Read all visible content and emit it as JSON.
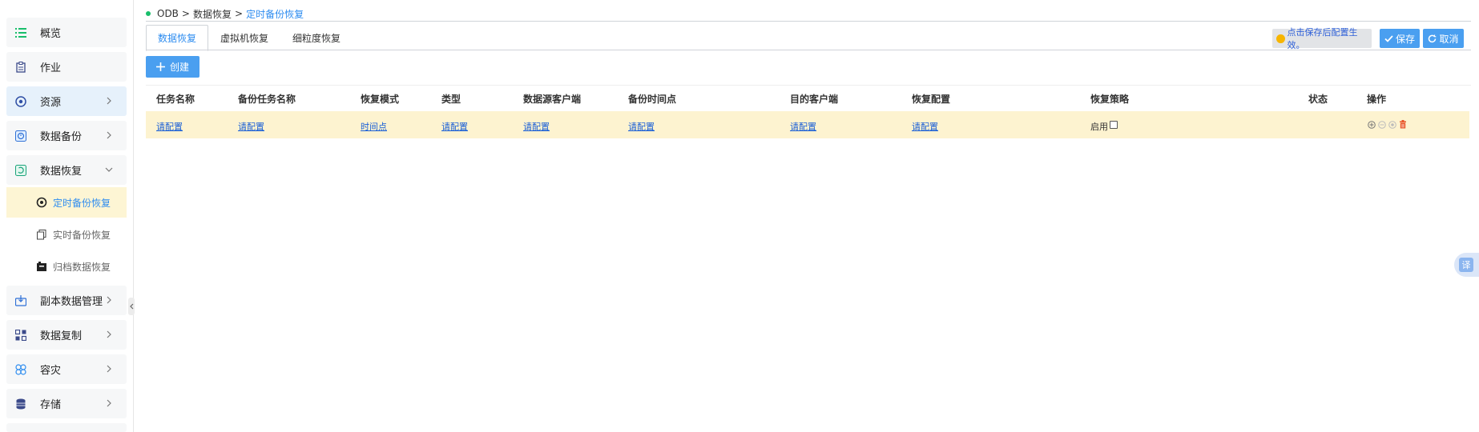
{
  "sidebar": {
    "items": [
      {
        "label": "概览",
        "icon": "list-icon"
      },
      {
        "label": "作业",
        "icon": "clipboard-icon"
      },
      {
        "label": "资源",
        "icon": "resource-icon"
      },
      {
        "label": "数据备份",
        "icon": "backup-icon"
      },
      {
        "label": "数据恢复",
        "icon": "restore-icon"
      },
      {
        "label": "副本数据管理",
        "icon": "copy-data-icon"
      },
      {
        "label": "数据复制",
        "icon": "replicate-icon"
      },
      {
        "label": "容灾",
        "icon": "disaster-icon"
      },
      {
        "label": "存储",
        "icon": "storage-icon"
      }
    ],
    "sub_items": [
      {
        "label": "定时备份恢复",
        "icon": "target-icon"
      },
      {
        "label": "实时备份恢复",
        "icon": "copy-icon"
      },
      {
        "label": "归档数据恢复",
        "icon": "archive-icon"
      }
    ]
  },
  "breadcrumb": {
    "root": "ODB",
    "sep1": ">",
    "level1": "数据恢复",
    "sep2": ">",
    "current": "定时备份恢复"
  },
  "tabs": [
    "数据恢复",
    "虚拟机恢复",
    "细粒度恢复"
  ],
  "toolbar": {
    "notice": "点击保存后配置生效。",
    "save_label": "保存",
    "cancel_label": "取消",
    "create_label": "创建"
  },
  "table": {
    "columns": [
      "任务名称",
      "备份任务名称",
      "恢复模式",
      "类型",
      "数据源客户端",
      "备份时间点",
      "目的客户端",
      "恢复配置",
      "恢复策略",
      "状态",
      "操作"
    ],
    "rows": [
      {
        "task_name": "请配置",
        "backup_task": "请配置",
        "mode": "时间点",
        "type": "请配置",
        "source_client": "请配置",
        "backup_time": "请配置",
        "dest_client": "请配置",
        "restore_config": "请配置",
        "policy_label": "启用",
        "status": ""
      }
    ]
  },
  "translate_badge": "译",
  "colors": {
    "accent": "#4a9ff0",
    "active_row": "#fdf3d0",
    "link": "#1a5fd6",
    "active_sub": "#fdf5d4"
  }
}
